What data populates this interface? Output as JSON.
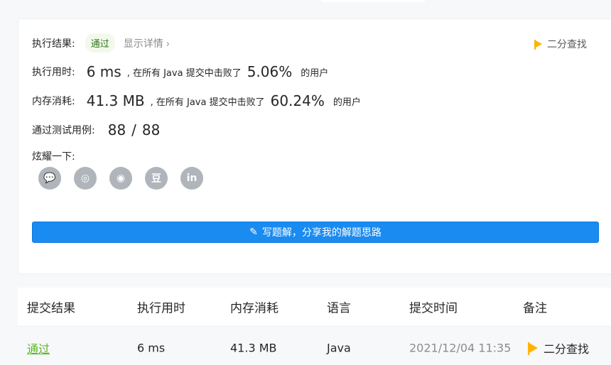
{
  "result": {
    "label": "执行结果:",
    "status": "通过",
    "detail_link": "显示详情",
    "chevron": "›",
    "tag": "二分查找"
  },
  "runtime": {
    "label": "执行用时:",
    "value": "6 ms",
    "text_before": ", 在所有 Java 提交中击败了",
    "percent": "5.06%",
    "text_after": "的用户"
  },
  "memory": {
    "label": "内存消耗:",
    "value": "41.3 MB",
    "text_before": ", 在所有 Java 提交中击败了",
    "percent": "60.24%",
    "text_after": "的用户"
  },
  "tests": {
    "label": "通过测试用例:",
    "passed": "88",
    "sep": "/",
    "total": "88"
  },
  "share": {
    "label": "炫耀一下:",
    "icons": [
      "wechat-icon",
      "weibo-icon",
      "qq-icon",
      "douban-icon",
      "linkedin-icon"
    ],
    "glyphs": [
      "💬",
      "◎",
      "◉",
      "豆",
      "in"
    ]
  },
  "write_button": {
    "icon": "✎",
    "label": "写题解，分享我的解题思路"
  },
  "table": {
    "headers": [
      "提交结果",
      "执行用时",
      "内存消耗",
      "语言",
      "提交时间",
      "备注"
    ],
    "row": {
      "result": "通过",
      "runtime": "6 ms",
      "memory": "41.3 MB",
      "language": "Java",
      "time": "2021/12/04 11:35",
      "note": "二分查找"
    }
  },
  "colors": {
    "accent": "#1a8bf0",
    "success": "#5ab726",
    "flag": "#ffb300"
  }
}
